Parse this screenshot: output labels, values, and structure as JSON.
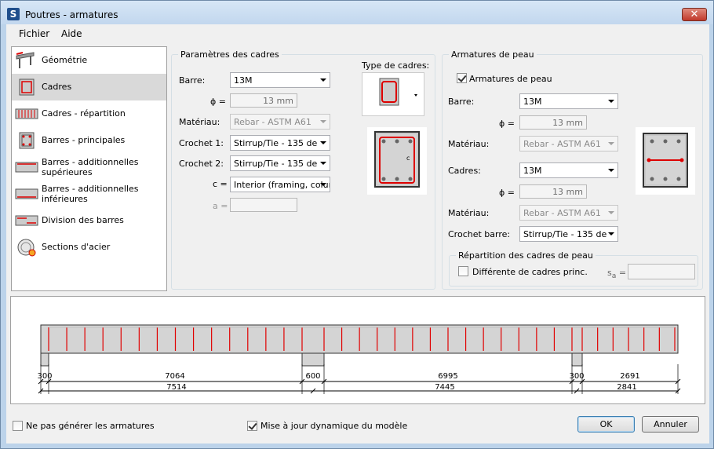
{
  "window": {
    "title": "Poutres - armatures",
    "app_icon": "S",
    "close": "✕"
  },
  "menu": [
    "Fichier",
    "Aide"
  ],
  "nav": [
    {
      "label": "Géométrie",
      "icon": "beam-geometry-icon"
    },
    {
      "label": "Cadres",
      "icon": "stirrup-icon",
      "selected": true
    },
    {
      "label": "Cadres - répartition",
      "icon": "stirrup-distribution-icon"
    },
    {
      "label": "Barres - principales",
      "icon": "main-bars-icon"
    },
    {
      "label": "Barres - additionnelles supérieures",
      "icon": "top-bars-icon"
    },
    {
      "label": "Barres - additionnelles inférieures",
      "icon": "bottom-bars-icon"
    },
    {
      "label": "Division des barres",
      "icon": "bar-division-icon"
    },
    {
      "label": "Sections d'acier",
      "icon": "steel-section-icon"
    }
  ],
  "cadres": {
    "title": "Paramètres des cadres",
    "barre_label": "Barre:",
    "barre_value": "13M",
    "phi_label": "ϕ =",
    "phi_value": "13 mm",
    "materiau_label": "Matériau:",
    "materiau_value": "Rebar - ASTM A61",
    "crochet1_label": "Crochet 1:",
    "crochet1_value": "Stirrup/Tie - 135 de",
    "crochet2_label": "Crochet 2:",
    "crochet2_value": "Stirrup/Tie - 135 de",
    "c_label": "c =",
    "c_value": "Interior (framing, colum",
    "a_label": "a =",
    "a_value": "",
    "type_label": "Type de cadres:"
  },
  "peau": {
    "title": "Armatures de peau",
    "checkbox_label": "Armatures de peau",
    "checked": true,
    "barre_label": "Barre:",
    "barre_value": "13M",
    "phi1_label": "ϕ =",
    "phi1_value": "13 mm",
    "materiau1_label": "Matériau:",
    "materiau1_value": "Rebar - ASTM A61",
    "cadres_label": "Cadres:",
    "cadres_value": "13M",
    "phi2_label": "ϕ =",
    "phi2_value": "13 mm",
    "materiau2_label": "Matériau:",
    "materiau2_value": "Rebar - ASTM A61",
    "crochet_label": "Crochet barre:",
    "crochet_value": "Stirrup/Tie - 135 de",
    "repartition_title": "Répartition des cadres de peau",
    "diff_label": "Différente de cadres princ.",
    "diff_checked": false,
    "sa_label": "s",
    "sa_sub": "a",
    "sa_eq": "=",
    "sa_value": ""
  },
  "beam": {
    "row1": [
      "300",
      "7064",
      "600",
      "6995",
      "300",
      "2691"
    ],
    "row2": [
      "7514",
      "7445",
      "2841"
    ]
  },
  "footer": {
    "no_gen_label": "Ne pas générer les armatures",
    "no_gen_checked": false,
    "dyn_label": "Mise à jour dynamique du modèle",
    "dyn_checked": true,
    "ok": "OK",
    "cancel": "Annuler"
  },
  "colors": {
    "rebar": "#e00000",
    "concrete": "#d4d4d4",
    "selected": "#d9d9d9"
  }
}
